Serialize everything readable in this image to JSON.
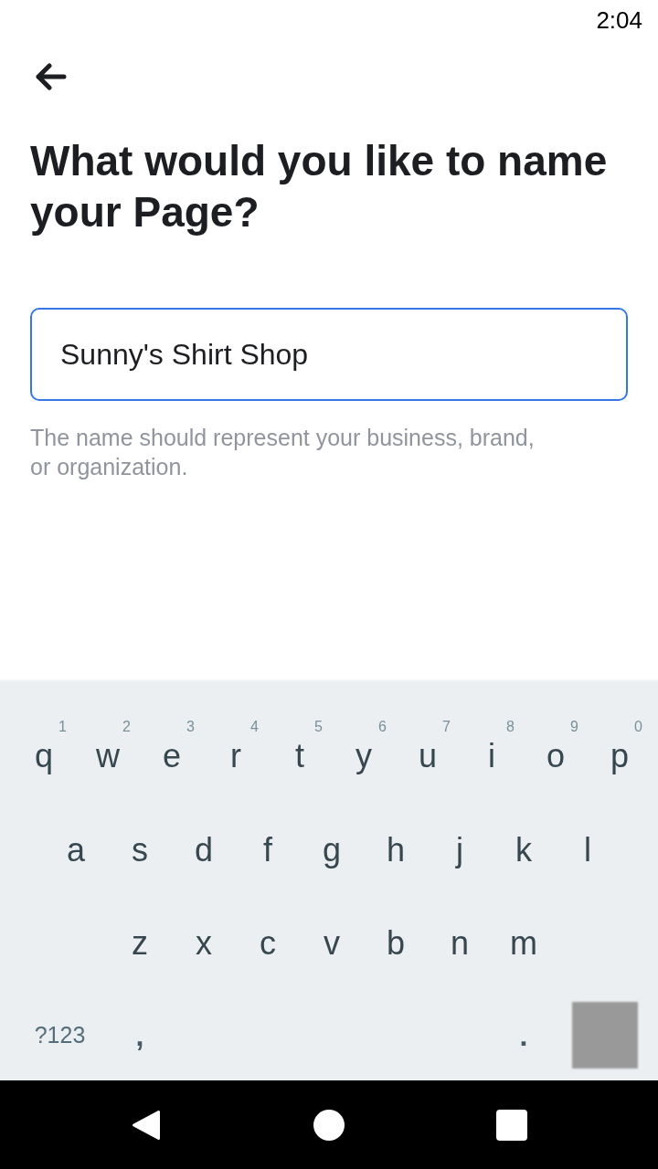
{
  "status_bar": {
    "time": "2:04"
  },
  "page": {
    "title": "What would you like to name your Page?",
    "name_field": {
      "value": "Sunny's Shirt Shop",
      "focused": true
    },
    "helper_text": "The name should represent your business, brand, or organization."
  },
  "keyboard": {
    "rows": [
      [
        {
          "label": "q",
          "hint": "1"
        },
        {
          "label": "w",
          "hint": "2"
        },
        {
          "label": "e",
          "hint": "3"
        },
        {
          "label": "r",
          "hint": "4"
        },
        {
          "label": "t",
          "hint": "5"
        },
        {
          "label": "y",
          "hint": "6"
        },
        {
          "label": "u",
          "hint": "7"
        },
        {
          "label": "i",
          "hint": "8"
        },
        {
          "label": "o",
          "hint": "9"
        },
        {
          "label": "p",
          "hint": "0"
        }
      ],
      [
        {
          "label": "a"
        },
        {
          "label": "s"
        },
        {
          "label": "d"
        },
        {
          "label": "f"
        },
        {
          "label": "g"
        },
        {
          "label": "h"
        },
        {
          "label": "j"
        },
        {
          "label": "k"
        },
        {
          "label": "l"
        }
      ],
      [
        {
          "label": "z"
        },
        {
          "label": "x"
        },
        {
          "label": "c"
        },
        {
          "label": "v"
        },
        {
          "label": "b"
        },
        {
          "label": "n"
        },
        {
          "label": "m"
        }
      ]
    ],
    "bottom_left": [
      {
        "kind": "symbols",
        "label": "?123"
      },
      {
        "kind": "char",
        "label": ","
      }
    ],
    "bottom_right": [
      {
        "kind": "char",
        "label": "."
      },
      {
        "kind": "blurred"
      }
    ]
  },
  "nav_bar": {
    "buttons": [
      {
        "kind": "back"
      },
      {
        "kind": "home"
      },
      {
        "kind": "recents"
      }
    ]
  }
}
